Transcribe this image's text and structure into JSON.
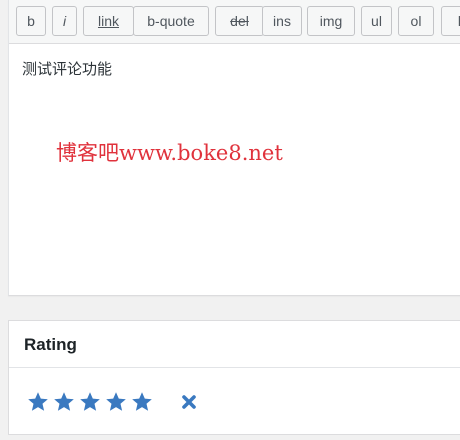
{
  "toolbar": {
    "buttons": [
      {
        "label": "b"
      },
      {
        "label": "i"
      },
      {
        "label": "link"
      },
      {
        "label": "b-quote"
      },
      {
        "label": "del"
      },
      {
        "label": "ins"
      },
      {
        "label": "img"
      },
      {
        "label": "ul"
      },
      {
        "label": "ol"
      },
      {
        "label": "li"
      }
    ]
  },
  "editor": {
    "content": "测试评论功能",
    "watermark": "博客吧www.boke8.net"
  },
  "rating": {
    "title": "Rating",
    "stars_total": 5,
    "stars_filled": 5,
    "star_color": "#3a79c0",
    "clear_icon": "close-icon"
  },
  "colors": {
    "background": "#f1f1f1",
    "watermark": "#e0323c",
    "accent": "#3a79c0"
  }
}
